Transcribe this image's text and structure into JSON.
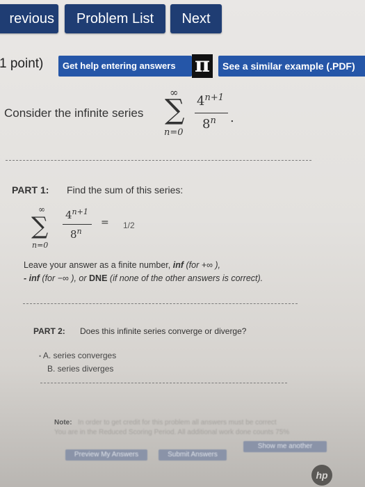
{
  "nav": {
    "previous": "revious",
    "problem_list": "Problem List",
    "next": "Next"
  },
  "problem": {
    "points": "1 point)",
    "help_entering": "Get help entering answers",
    "pi_icon_text": "π",
    "similar_example": "See a similar example (.PDF)",
    "consider": "Consider the infinite series",
    "series": {
      "sum_upper": "∞",
      "sum_lower": "n=0",
      "numerator_base": "4",
      "numerator_exp": "n+1",
      "denominator_base": "8",
      "denominator_exp": "n",
      "period": "."
    }
  },
  "part1": {
    "label": "PART 1:",
    "question": "Find the sum of this series:",
    "answer_value": "1/2",
    "equals": "=",
    "instr_line1_a": "Leave your answer as a finite number,",
    "instr_line1_b": "inf",
    "instr_line1_c": "(for +∞ ),",
    "instr_line2_a": "- inf",
    "instr_line2_b": "(for  −∞ ), or",
    "instr_line2_c": "DNE",
    "instr_line2_d": "(if none of the other answers is correct)."
  },
  "part2": {
    "label": "PART 2:",
    "question": "Does this infinite series converge or diverge?",
    "option_a": "A. series converges",
    "option_b": "B. series diverges"
  },
  "footer": {
    "note_label": "Note:",
    "note_text": "In order to get credit for this problem all answers must be correct",
    "note_text2": "You are in the Reduced Scoring Period. All additional work done counts 75%",
    "preview_button": "Preview My Answers",
    "submit_button": "Submit Answers",
    "show_another": "Show me another",
    "hp_logo": "hp"
  },
  "colors": {
    "nav_button": "#1f3d73",
    "help_button": "#2556a8",
    "pi_box": "#111111"
  }
}
